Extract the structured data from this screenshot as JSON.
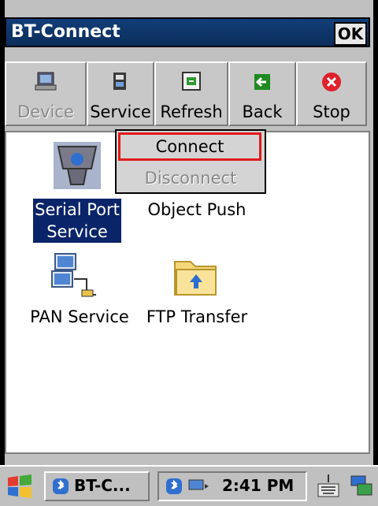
{
  "window": {
    "title": "BT-Connect",
    "ok_label": "OK"
  },
  "toolbar": {
    "device": "Device",
    "service": "Service",
    "refresh": "Refresh",
    "back": "Back",
    "stop": "Stop"
  },
  "services": [
    {
      "label_line1": "Serial Port",
      "label_line2": "Service"
    },
    {
      "label": "Object Push"
    },
    {
      "label": "PAN Service"
    },
    {
      "label": "FTP Transfer"
    }
  ],
  "context_menu": {
    "connect": "Connect",
    "disconnect": "Disconnect"
  },
  "taskbar": {
    "app_label": "BT-C...",
    "time": "2:41 PM"
  },
  "colors": {
    "title_bg": "#0b2d5c",
    "selection_bg": "#0a246a",
    "highlight_border": "#e21a1a"
  }
}
